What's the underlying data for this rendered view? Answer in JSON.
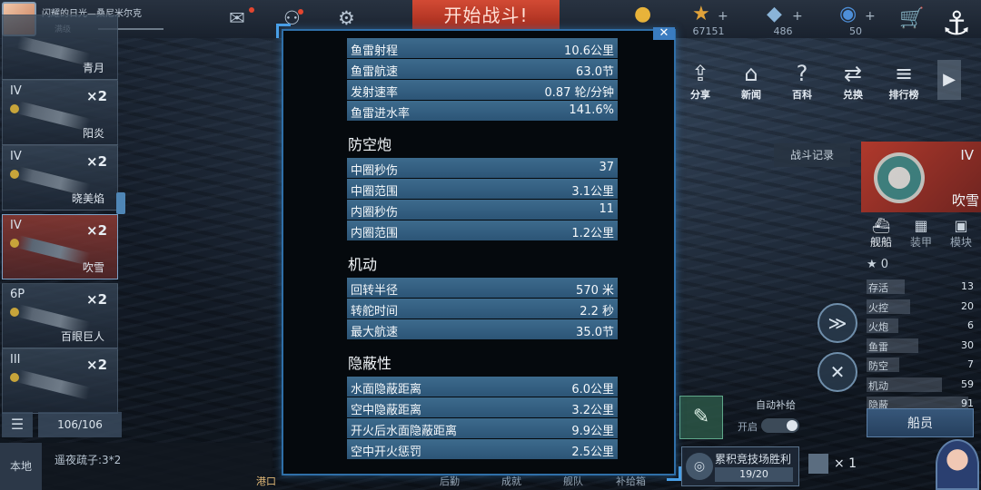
{
  "topbar": {
    "player_name": "闪耀的日光—桑尼米尔克",
    "player_rank": "满级",
    "start_battle": "开始战斗!",
    "resources": [
      {
        "icon": "gold-coin-icon",
        "glyph": "●",
        "color": "#e8b33a",
        "value": "",
        "show_plus": false
      },
      {
        "icon": "star-icon",
        "glyph": "★",
        "color": "#e0a23a",
        "value": "67151",
        "show_plus": true
      },
      {
        "icon": "diamond-icon",
        "glyph": "◆",
        "color": "#8ab4d8",
        "value": "486",
        "show_plus": true
      },
      {
        "icon": "fuel-drop-icon",
        "glyph": "◉",
        "color": "#4e8fd8",
        "value": "50",
        "show_plus": true
      }
    ]
  },
  "ship_list": [
    {
      "tier": "",
      "name": "青月",
      "count": ""
    },
    {
      "tier": "IV",
      "name": "阳炎",
      "count": "×2"
    },
    {
      "tier": "IV",
      "name": "晓美焰",
      "count": "×2"
    },
    {
      "tier": "IV",
      "name": "吹雪",
      "count": "×2"
    },
    {
      "tier": "6P",
      "name": "百眼巨人",
      "count": "×2"
    },
    {
      "tier": "III",
      "name": "",
      "count": "×2"
    }
  ],
  "dock_count": "106/106",
  "chat": {
    "channel": "本地",
    "message": "遥夜疏子:3*2"
  },
  "bottom_nav": [
    "港口",
    "",
    "",
    "后勤",
    "成就",
    "舰队",
    "补给箱"
  ],
  "features": [
    {
      "label": "分享",
      "glyph": "⇪"
    },
    {
      "label": "新闻",
      "glyph": "⌂"
    },
    {
      "label": "百科",
      "glyph": "?"
    },
    {
      "label": "兑换",
      "glyph": "⇄"
    },
    {
      "label": "排行榜",
      "glyph": "≡"
    }
  ],
  "battle_log": "战斗记录",
  "detail": {
    "tier": "IV",
    "name": "吹雪",
    "tabs": [
      "舰船",
      "装甲",
      "模块"
    ],
    "stars": "0",
    "stats": [
      {
        "label": "存活",
        "value": "13"
      },
      {
        "label": "火控",
        "value": "20"
      },
      {
        "label": "火炮",
        "value": "6"
      },
      {
        "label": "鱼雷",
        "value": "30"
      },
      {
        "label": "防空",
        "value": "7"
      },
      {
        "label": "机动",
        "value": "59"
      },
      {
        "label": "隐蔽",
        "value": "91"
      }
    ],
    "crew": "船员"
  },
  "supply": {
    "title": "自动补给",
    "toggle_label": "开启"
  },
  "arena": {
    "title": "累积竞技场胜利",
    "progress": "19/20",
    "reward": "× 1"
  },
  "modal": {
    "close": "✕",
    "sections": [
      {
        "title": "",
        "rows": [
          {
            "k": "鱼雷射程",
            "v": "10.6公里"
          },
          {
            "k": "鱼雷航速",
            "v": "63.0节"
          },
          {
            "k": "发射速率",
            "v": "0.87 轮/分钟"
          },
          {
            "k": "鱼雷进水率",
            "v": "141.6%"
          }
        ]
      },
      {
        "title": "防空炮",
        "rows": [
          {
            "k": "中圈秒伤",
            "v": "37"
          },
          {
            "k": "中圈范围",
            "v": "3.1公里"
          },
          {
            "k": "内圈秒伤",
            "v": "11"
          },
          {
            "k": "内圈范围",
            "v": "1.2公里"
          }
        ]
      },
      {
        "title": "机动",
        "rows": [
          {
            "k": "回转半径",
            "v": "570 米"
          },
          {
            "k": "转舵时间",
            "v": "2.2 秒"
          },
          {
            "k": "最大航速",
            "v": "35.0节"
          }
        ]
      },
      {
        "title": "隐蔽性",
        "rows": [
          {
            "k": "水面隐蔽距离",
            "v": "6.0公里"
          },
          {
            "k": "空中隐蔽距离",
            "v": "3.2公里"
          },
          {
            "k": "开火后水面隐蔽距离",
            "v": "9.9公里"
          },
          {
            "k": "空中开火惩罚",
            "v": "2.5公里"
          }
        ]
      }
    ]
  }
}
